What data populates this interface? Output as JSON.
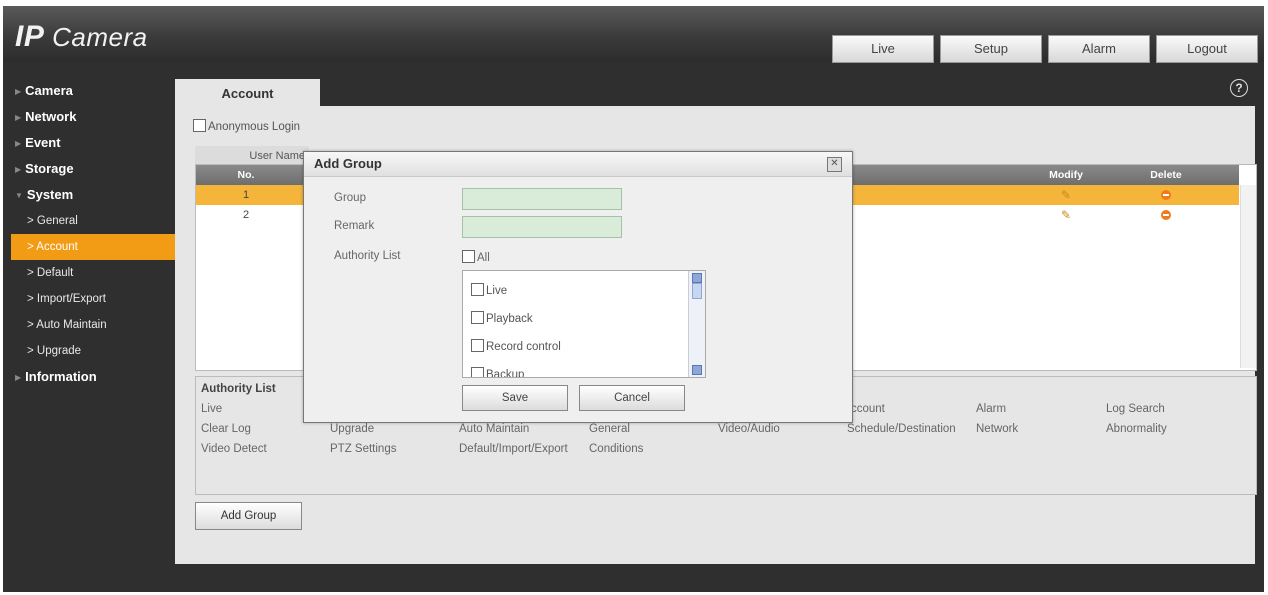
{
  "app": {
    "title_ip": "IP",
    "title_rest": " Camera"
  },
  "topnav": [
    "Live",
    "Setup",
    "Alarm",
    "Logout"
  ],
  "sidebar": {
    "items": [
      {
        "label": "Camera"
      },
      {
        "label": "Network"
      },
      {
        "label": "Event"
      },
      {
        "label": "Storage"
      },
      {
        "label": "System"
      }
    ],
    "system_subitems": [
      "General",
      "Account",
      "Default",
      "Import/Export",
      "Auto Maintain",
      "Upgrade"
    ],
    "information": "Information"
  },
  "tab": {
    "label": "Account"
  },
  "help": "?",
  "anonymous_login": "Anonymous Login",
  "user_table": {
    "header_user_name": "User Name",
    "header_no": "No.",
    "header_modify": "Modify",
    "header_delete": "Delete",
    "rows": [
      {
        "no": "1"
      },
      {
        "no": "2"
      }
    ]
  },
  "authority": {
    "title": "Authority List",
    "items": [
      "Live",
      "Clear Log",
      "Upgrade",
      "Auto Maintain",
      "General",
      "Video/Audio",
      "Schedule/Destination",
      "Network",
      "Abnormality",
      "Video Detect",
      "PTZ Settings",
      "Default/Import/Export",
      "Conditions",
      "ccount",
      "Alarm",
      "Log Search"
    ]
  },
  "add_group_button": "Add Group",
  "modal": {
    "title": "Add Group",
    "group_label": "Group",
    "remark_label": "Remark",
    "authority_label": "Authority List",
    "all_label": "All",
    "list": [
      "Live",
      "Playback",
      "Record control",
      "Backup"
    ],
    "save": "Save",
    "cancel": "Cancel"
  }
}
